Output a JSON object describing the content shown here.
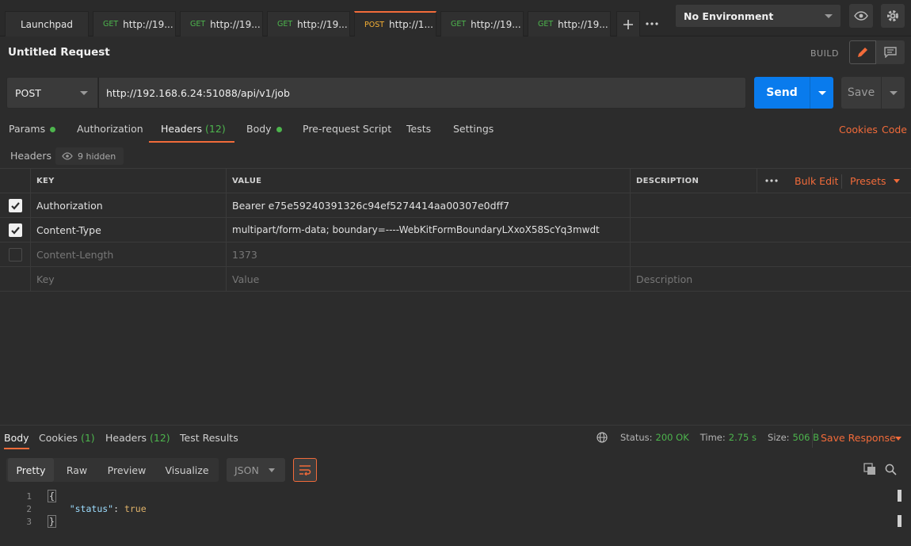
{
  "tabs": [
    {
      "method": "",
      "label": "Launchpad",
      "dirty": false,
      "active": false
    },
    {
      "method": "GET",
      "label": "http://19...",
      "dirty": true,
      "active": false
    },
    {
      "method": "GET",
      "label": "http://19...",
      "dirty": true,
      "active": false
    },
    {
      "method": "GET",
      "label": "http://19...",
      "dirty": true,
      "active": false
    },
    {
      "method": "POST",
      "label": "http://1...",
      "dirty": true,
      "active": true
    },
    {
      "method": "GET",
      "label": "http://19...",
      "dirty": true,
      "active": false
    },
    {
      "method": "GET",
      "label": "http://19...",
      "dirty": true,
      "active": false
    }
  ],
  "environment": {
    "selected": "No Environment"
  },
  "request": {
    "title": "Untitled Request",
    "mode": "BUILD",
    "method": "POST",
    "url": "http://192.168.6.24:51088/api/v1/job",
    "send_label": "Send",
    "save_label": "Save"
  },
  "request_tabs": {
    "params": "Params",
    "authorization": "Authorization",
    "headers": "Headers",
    "headers_count": "(12)",
    "body": "Body",
    "prerequest": "Pre-request Script",
    "tests": "Tests",
    "settings": "Settings",
    "cookies": "Cookies",
    "code": "Code"
  },
  "headers_section": {
    "label": "Headers",
    "hidden": "9 hidden",
    "columns": {
      "key": "KEY",
      "value": "VALUE",
      "description": "DESCRIPTION"
    },
    "bulk_edit": "Bulk Edit",
    "presets": "Presets",
    "rows": [
      {
        "key": "Authorization",
        "value": "Bearer e75e59240391326c94ef5274414aa00307e0dff7",
        "checked": true
      },
      {
        "key": "Content-Type",
        "value": "multipart/form-data; boundary=----WebKitFormBoundaryLXxoX58ScYq3mwdt",
        "checked": true
      },
      {
        "key": "Content-Length",
        "value": "1373",
        "checked": false
      }
    ],
    "placeholder": {
      "key": "Key",
      "value": "Value",
      "description": "Description"
    }
  },
  "response": {
    "tabs": {
      "body": "Body",
      "cookies": "Cookies",
      "cookies_count": "(1)",
      "headers": "Headers",
      "headers_count": "(12)",
      "test_results": "Test Results"
    },
    "status_label": "Status:",
    "status": "200 OK",
    "time_label": "Time:",
    "time": "2.75 s",
    "size_label": "Size:",
    "size": "506 B",
    "save_response": "Save Response",
    "views": {
      "pretty": "Pretty",
      "raw": "Raw",
      "preview": "Preview",
      "visualize": "Visualize"
    },
    "format": "JSON",
    "lines": [
      "1",
      "2",
      "3"
    ],
    "json_key": "\"status\"",
    "json_value": "true"
  },
  "colors": {
    "accent": "#f26b3a",
    "send": "#097bed",
    "success": "#4db54d"
  }
}
